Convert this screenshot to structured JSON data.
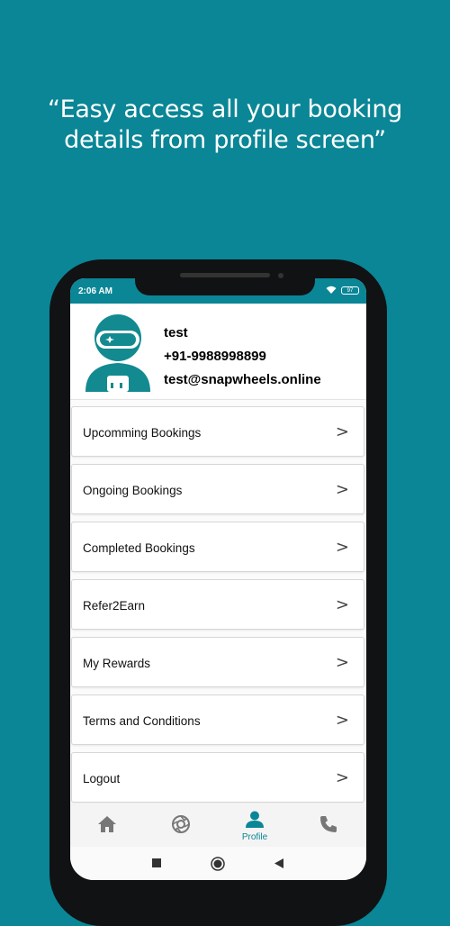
{
  "caption": {
    "line1": "“Easy access all your booking",
    "line2": "details from profile screen”"
  },
  "status_bar": {
    "time": "2:06 AM",
    "battery": "97"
  },
  "profile": {
    "name": "test",
    "phone": "+91-9988998899",
    "email": "test@snapwheels.online"
  },
  "menu": {
    "items": [
      {
        "label": "Upcomming Bookings",
        "arrow": ">"
      },
      {
        "label": "Ongoing Bookings",
        "arrow": ">"
      },
      {
        "label": "Completed Bookings",
        "arrow": ">"
      },
      {
        "label": "Refer2Earn",
        "arrow": ">"
      },
      {
        "label": "My Rewards",
        "arrow": ">"
      },
      {
        "label": "Terms and Conditions",
        "arrow": ">"
      },
      {
        "label": "Logout",
        "arrow": ">"
      }
    ]
  },
  "bottom_nav": {
    "items": [
      {
        "icon": "home-icon"
      },
      {
        "icon": "aperture-icon"
      },
      {
        "icon": "profile-icon",
        "label": "Profile",
        "active": true
      },
      {
        "icon": "phone-icon"
      }
    ]
  },
  "colors": {
    "brand": "#0a8696",
    "background": "#0a8696"
  }
}
